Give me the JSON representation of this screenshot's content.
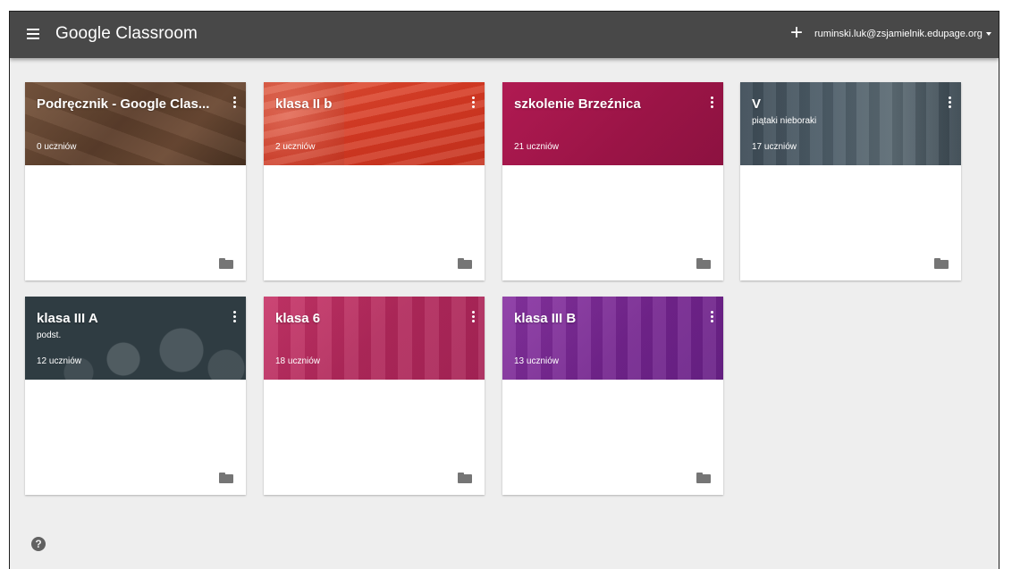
{
  "header": {
    "app_title": "Google Classroom",
    "add_symbol": "+",
    "account_email": "ruminski.luk@zsjamielnik.edupage.org"
  },
  "help_symbol": "?",
  "colors": {
    "topbar": "#484848",
    "page_background": "#eeeeee",
    "folder_icon": "#757575"
  },
  "icons": {
    "menu": "menu-icon",
    "add": "add-icon",
    "account_caret": "caret-down-icon",
    "card_menu": "more-vert-icon",
    "folder": "folder-icon",
    "help": "help-icon"
  },
  "classes": [
    {
      "title": "Podręcznik - Google Clas...",
      "subtitle": "",
      "count": "0 uczniów",
      "theme": "#6b4a35"
    },
    {
      "title": "klasa II b",
      "subtitle": "",
      "count": "2 uczniów",
      "theme": "#d9452b"
    },
    {
      "title": "szkolenie Brzeźnica",
      "subtitle": "",
      "count": "21 uczniów",
      "theme": "#a3174a"
    },
    {
      "title": "V",
      "subtitle": "piątaki nieboraki",
      "count": "17 uczniów",
      "theme": "#3c4a55"
    },
    {
      "title": "klasa III A",
      "subtitle": "podst.",
      "count": "12 uczniów",
      "theme": "#2d3a40"
    },
    {
      "title": "klasa 6",
      "subtitle": "",
      "count": "18 uczniów",
      "theme": "#b83060"
    },
    {
      "title": "klasa III B",
      "subtitle": "",
      "count": "13 uczniów",
      "theme": "#7b2a95"
    }
  ]
}
